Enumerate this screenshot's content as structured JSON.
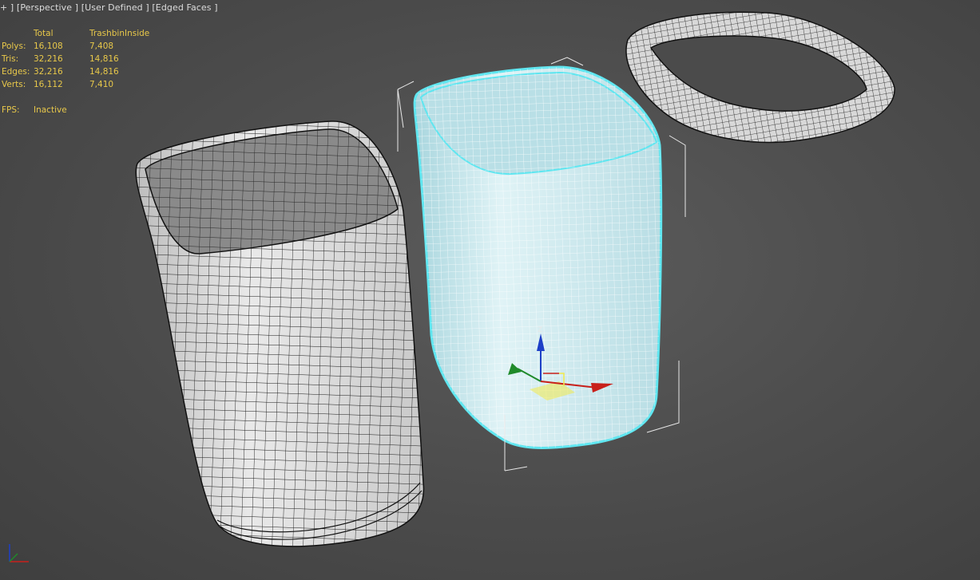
{
  "viewport": {
    "label_parts": [
      "+ ]",
      "[Perspective ]",
      "[User Defined ]",
      "[Edged Faces ]"
    ]
  },
  "stats": {
    "headers": [
      "",
      "Total",
      "TrashbinInside"
    ],
    "rows": [
      {
        "label": "Polys:",
        "total": "16,108",
        "selected": "7,408"
      },
      {
        "label": "Tris:",
        "total": "32,216",
        "selected": "14,816"
      },
      {
        "label": "Edges:",
        "total": "32,216",
        "selected": "14,816"
      },
      {
        "label": "Verts:",
        "total": "16,112",
        "selected": "7,410"
      }
    ],
    "fps_label": "FPS:",
    "fps_value": "Inactive"
  },
  "gizmo": {
    "z_label": "Z",
    "colors": {
      "x": "#c8201a",
      "y": "#1f8a2a",
      "z": "#1d3fc7"
    }
  },
  "colors": {
    "selection_outline": "#5fe6f0",
    "selected_fill": "#d7eef3",
    "unselected_fill": "#e6e6e6",
    "stats_text": "#e8c84a",
    "label_text": "#dcdcdc"
  }
}
